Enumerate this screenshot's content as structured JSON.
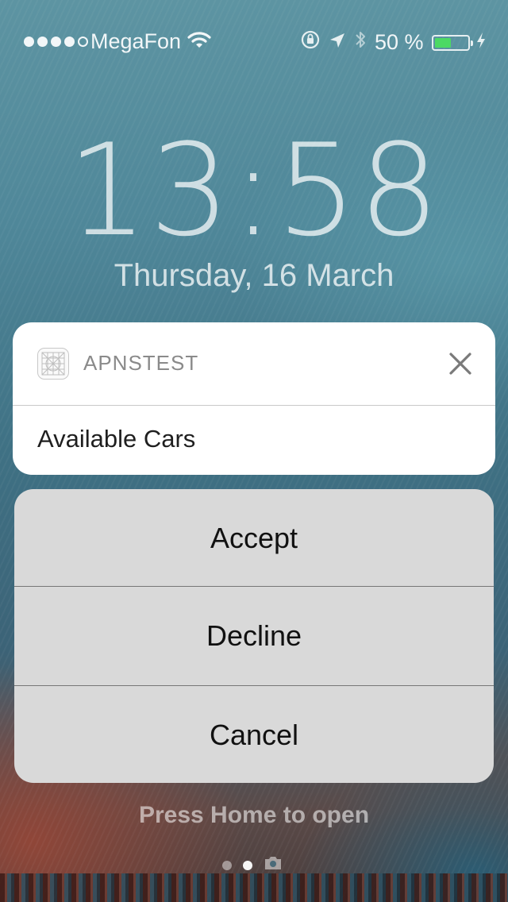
{
  "status_bar": {
    "carrier": "MegaFon",
    "signal_bars_filled": 4,
    "signal_bars_total": 5,
    "battery_text": "50 %",
    "battery_level": 0.5,
    "icons": [
      "wifi-icon",
      "orientation-lock-icon",
      "location-arrow-icon",
      "bluetooth-icon",
      "battery-icon",
      "charging-bolt-icon"
    ]
  },
  "lock_screen": {
    "time": "13:58",
    "date": "Thursday, 16 March",
    "hint": "Press Home to open",
    "page_indicator": {
      "pages": 2,
      "current": 1,
      "extra_icon": "camera-icon"
    }
  },
  "notification": {
    "app_name": "APNSTEST",
    "app_icon": "app-placeholder-icon",
    "message": "Available Cars",
    "close_icon": "close-icon"
  },
  "actions": [
    {
      "label": "Accept"
    },
    {
      "label": "Decline"
    },
    {
      "label": "Cancel"
    }
  ],
  "colors": {
    "battery_fill": "#4cd964",
    "card_background": "#ffffff",
    "action_background": "#d9d9d9"
  }
}
